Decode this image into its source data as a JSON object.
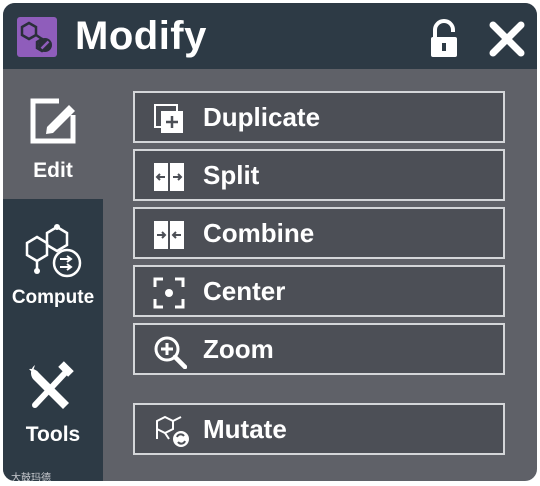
{
  "window": {
    "title": "Modify",
    "app_icon": "molecule-edit-icon",
    "lock_icon": "unlock-icon",
    "close_icon": "close-icon"
  },
  "sidebar": {
    "tabs": [
      {
        "label": "Edit",
        "icon": "edit-icon",
        "active": true
      },
      {
        "label": "Compute",
        "icon": "compute-molecule-icon",
        "active": false
      },
      {
        "label": "Tools",
        "icon": "tools-icon",
        "active": false
      }
    ]
  },
  "actions": [
    {
      "label": "Duplicate",
      "icon": "duplicate-icon"
    },
    {
      "label": "Split",
      "icon": "split-icon"
    },
    {
      "label": "Combine",
      "icon": "combine-icon"
    },
    {
      "label": "Center",
      "icon": "center-icon"
    },
    {
      "label": "Zoom",
      "icon": "zoom-icon"
    },
    {
      "label": "Mutate",
      "icon": "mutate-icon"
    }
  ],
  "watermark": "大鼓玛德",
  "colors": {
    "titlebar": "#2d3a45",
    "panel": "#5f6168",
    "button_bg": "#4c4f56",
    "button_border": "#d4d6d9",
    "accent_purple": "#8f5dbb"
  }
}
